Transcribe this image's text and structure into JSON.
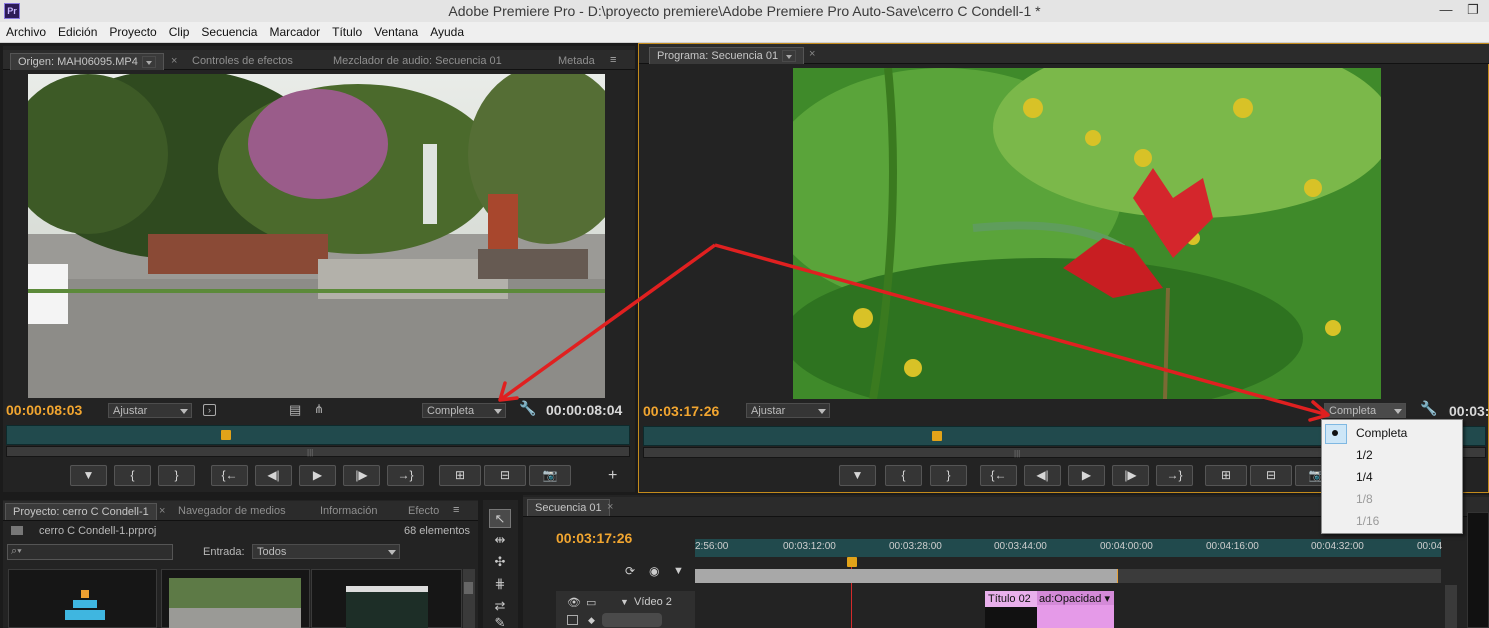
{
  "window": {
    "app_icon": "Pr",
    "title": "Adobe Premiere Pro - D:\\proyecto premiere\\Adobe Premiere Pro Auto-Save\\cerro C Condell-1 *"
  },
  "menu": [
    "Archivo",
    "Edición",
    "Proyecto",
    "Clip",
    "Secuencia",
    "Marcador",
    "Título",
    "Ventana",
    "Ayuda"
  ],
  "source": {
    "tabs": [
      "Origen: MAH06095.MP4",
      "Controles de efectos",
      "Mezclador de audio: Secuencia 01",
      "Metada"
    ],
    "timecode_in": "00:00:08:03",
    "fit": "Ajustar",
    "resolution": "Completa",
    "timecode_out": "00:00:08:04",
    "playhead": 0.3527,
    "buttons": [
      "▼",
      "{",
      "}",
      "{←",
      "◀|",
      "▶",
      "|▶",
      "→}",
      "⊞",
      "⊟",
      "📷"
    ]
  },
  "program": {
    "tab": "Programa: Secuencia 01",
    "timecode": "00:03:17:26",
    "fit": "Ajustar",
    "resolution": "Completa",
    "timecode_out": "00:03:",
    "playhead": 0.348
  },
  "resolution_menu": {
    "items": [
      {
        "label": "Completa",
        "checked": true,
        "enabled": true
      },
      {
        "label": "1/2",
        "enabled": true
      },
      {
        "label": "1/4",
        "enabled": true
      },
      {
        "label": "1/8",
        "enabled": false
      },
      {
        "label": "1/16",
        "enabled": false
      }
    ]
  },
  "project": {
    "tabs": [
      "Proyecto: cerro C Condell-1",
      "Navegador de medios",
      "Información",
      "Efecto"
    ],
    "file": "cerro C Condell-1.prproj",
    "count": "68 elementos",
    "search_placeholder": "",
    "entry_label": "Entrada:",
    "entry_value": "Todos"
  },
  "timeline": {
    "tab": "Secuencia 01",
    "timecode": "00:03:17:26",
    "ticks": [
      "2:56:00",
      "00:03:12:00",
      "00:03:28:00",
      "00:03:44:00",
      "00:04:00:00",
      "00:04:16:00",
      "00:04:32:00",
      "00:04"
    ],
    "track": "Vídeo 2",
    "clip_title": "Título 02",
    "clip_effect": "ad:Opacidad"
  },
  "colors": {
    "accent": "#f2a630",
    "annotation": "#e02020",
    "timeline_clip": "#e59ae8"
  }
}
